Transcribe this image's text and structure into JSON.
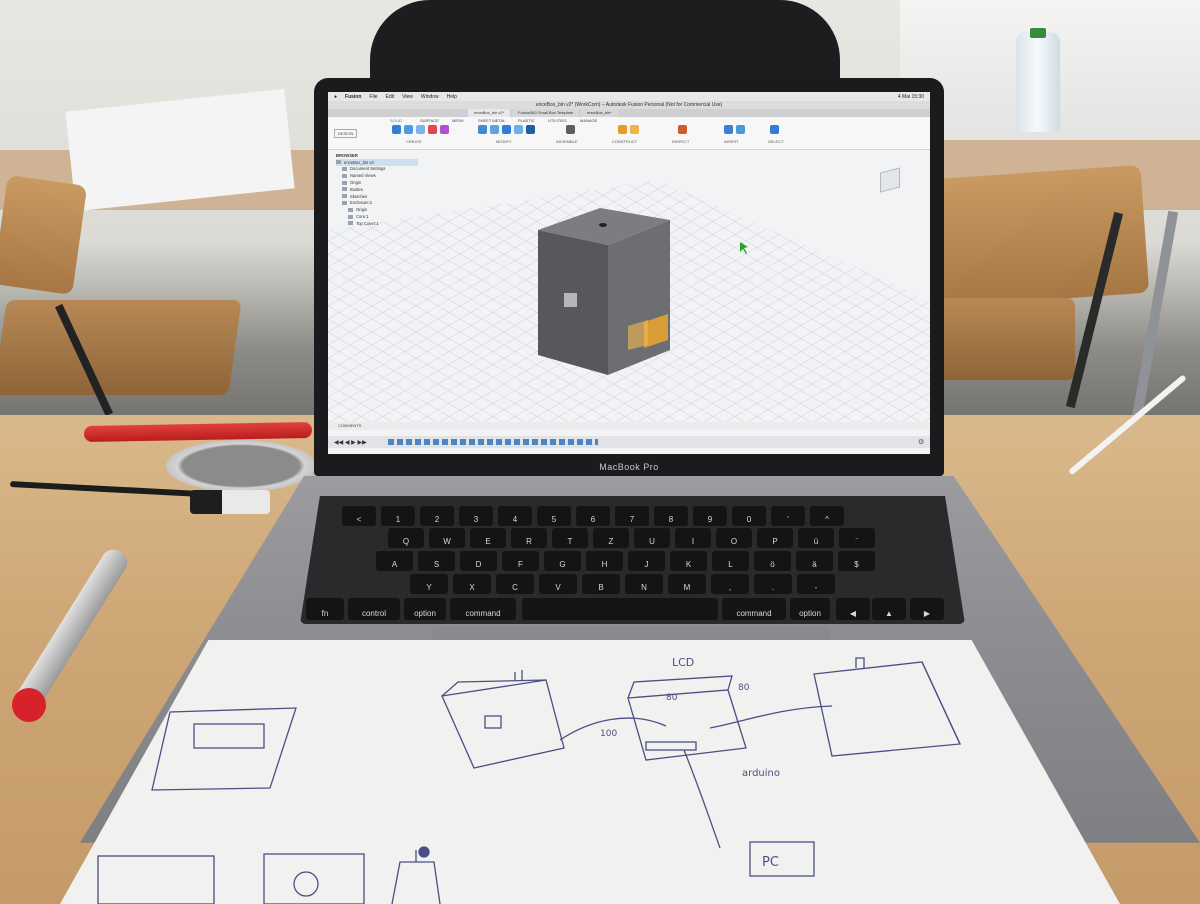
{
  "screen": {
    "menubar": {
      "app_name": "Fusion",
      "items": [
        "File",
        "Edit",
        "View",
        "Window",
        "Help"
      ],
      "clock": "4 Mai 15:30"
    },
    "window_title": "enceBox_bin v2* (WorkCorn) – Autodesk Fusion Personal (Not for Commercial Use)",
    "tabs": [
      "enceBox_bin v2*",
      "Fusion360 Small Box Template",
      "enceBox_bin*"
    ],
    "ribbon": {
      "workspace": "DESIGN",
      "tabs": [
        "SOLID",
        "SURFACE",
        "MESH",
        "SHEET METAL",
        "PLASTIC",
        "UTILITIES",
        "MANAGE"
      ],
      "groups": [
        "CREATE",
        "MODIFY",
        "ASSEMBLE",
        "CONSTRUCT",
        "INSPECT",
        "INSERT",
        "SELECT"
      ]
    },
    "browser": {
      "title": "BROWSER",
      "root": "enceBox_bin v2",
      "items": [
        "Document Settings",
        "Named Views",
        "Origin",
        "Bodies",
        "Sketches",
        "Enclosure:1",
        "Origin",
        "Core:1",
        "Top Cover:1"
      ]
    },
    "comments_label": "COMMENTS",
    "colors": {
      "ribbon_accent": "#2f7fd6",
      "model_body": "#5a5c5f",
      "selection_highlight": "#f4a928"
    }
  },
  "laptop": {
    "brand_label": "MacBook Pro"
  },
  "keyboard": {
    "row1": [
      "<",
      "1",
      "2",
      "3",
      "4",
      "5",
      "6",
      "7",
      "8",
      "9",
      "0",
      "'",
      "^"
    ],
    "row2": [
      "Q",
      "W",
      "E",
      "R",
      "T",
      "Z",
      "U",
      "I",
      "O",
      "P",
      "ü",
      "¨"
    ],
    "row3": [
      "A",
      "S",
      "D",
      "F",
      "G",
      "H",
      "J",
      "K",
      "L",
      "ö",
      "ä",
      "$"
    ],
    "row4": [
      "Y",
      "X",
      "C",
      "V",
      "B",
      "N",
      "M",
      ",",
      ".",
      "-"
    ],
    "mods_left": [
      "fn",
      "control",
      "option",
      "command"
    ],
    "mods_right": [
      "command",
      "option"
    ]
  },
  "sketch": {
    "labels": {
      "top": "LCD",
      "dim_a": "80",
      "dim_b": "80",
      "dim_c": "100",
      "board": "arduino",
      "computer": "PC"
    }
  }
}
